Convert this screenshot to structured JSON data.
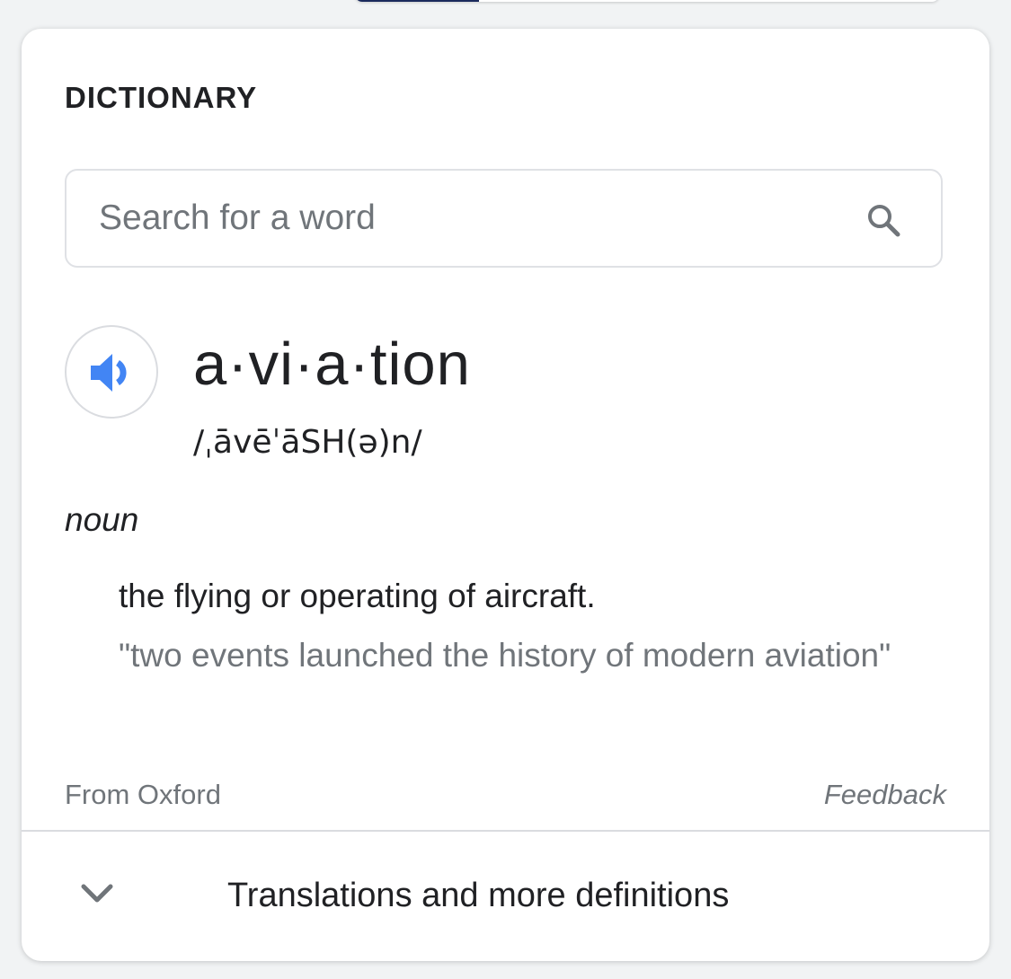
{
  "card": {
    "heading": "DICTIONARY"
  },
  "search": {
    "placeholder": "Search for a word",
    "icon": "search-icon"
  },
  "entry": {
    "speaker_icon": "speaker-icon",
    "headword": "a·vi·a·tion",
    "phonetic": "/ˌāvēˈāSH(ə)n/",
    "part_of_speech": "noun",
    "definition": "the flying or operating of aircraft.",
    "example": "\"two events launched the history of modern aviation\""
  },
  "footer": {
    "source": "From Oxford",
    "feedback": "Feedback"
  },
  "expand": {
    "icon": "chevron-down-icon",
    "label": "Translations and more definitions"
  },
  "colors": {
    "accent": "#4285f4",
    "text": "#202124",
    "muted": "#70757a",
    "border": "#dfe1e5"
  }
}
